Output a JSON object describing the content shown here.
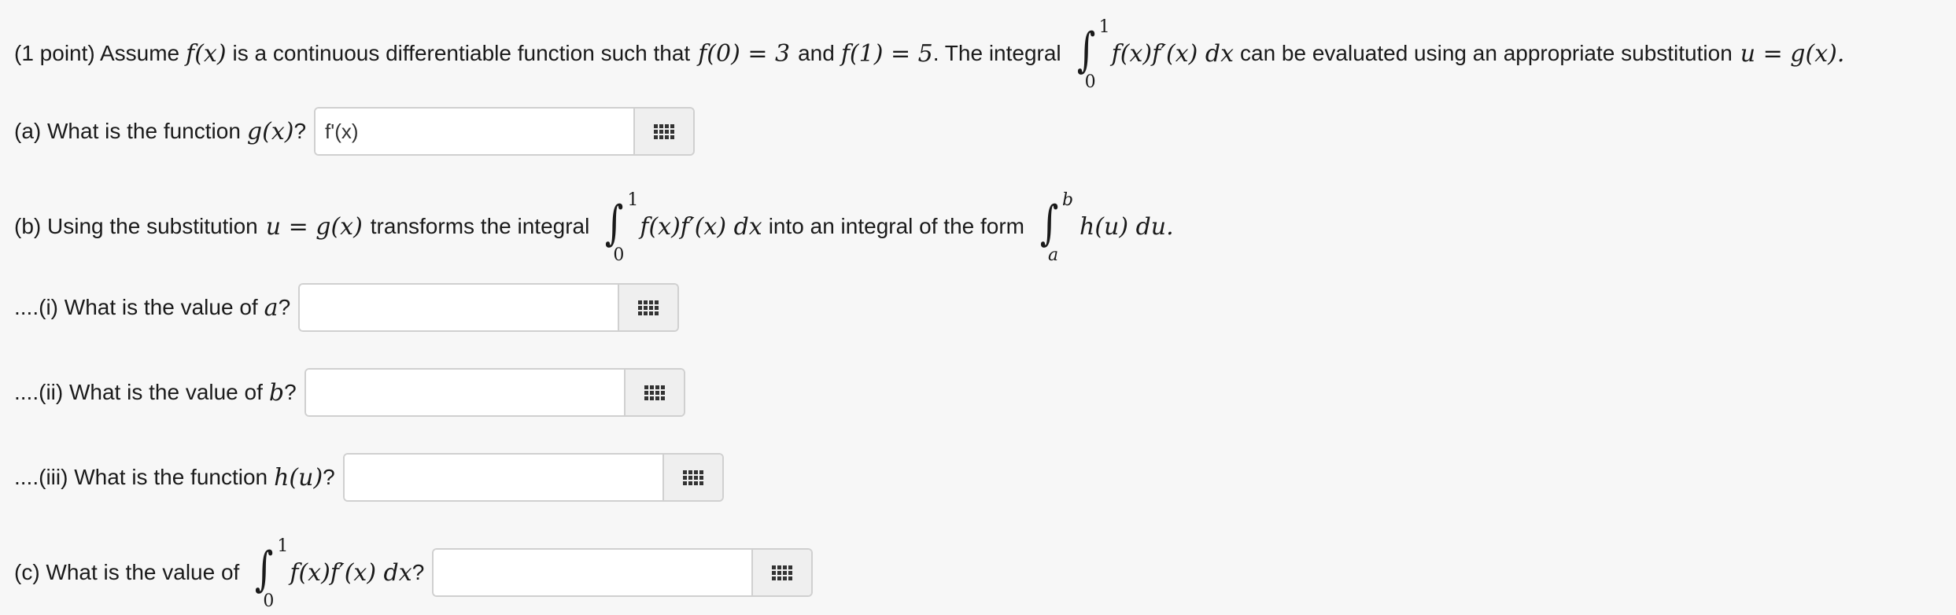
{
  "problem": {
    "intro_prefix": "(1 point) Assume",
    "intro_f": "f(x)",
    "intro_mid": "is a continuous differentiable function such that",
    "intro_cond1": "f(0) = 3",
    "intro_and": "and",
    "intro_cond2": "f(1) = 5",
    "intro_integral_label": ". The integral",
    "integral_upper": "1",
    "integral_lower": "0",
    "integrand": "f(x)f′(x) dx",
    "intro_suffix": "can be evaluated using an appropriate substitution",
    "substitution": "u = g(x)."
  },
  "part_a": {
    "label": "(a) What is the function",
    "symbol": "g(x)",
    "question_mark": "?",
    "input_value": "f'(x)",
    "input_placeholder": ""
  },
  "part_b": {
    "label_prefix": "(b) Using the substitution",
    "substitution": "u = g(x)",
    "label_mid": "transforms the integral",
    "integral_upper": "1",
    "integral_lower": "0",
    "integrand": "f(x)f′(x) dx",
    "label_form": "into an integral of the form",
    "form_upper": "b",
    "form_lower": "a",
    "form_integrand": "h(u) du."
  },
  "part_b_i": {
    "label": "....(i) What is the value of",
    "symbol": "a",
    "question_mark": "?",
    "input_value": ""
  },
  "part_b_ii": {
    "label": "....(ii) What is the value of",
    "symbol": "b",
    "question_mark": "?",
    "input_value": ""
  },
  "part_b_iii": {
    "label": "....(iii) What is the function",
    "symbol": "h(u)",
    "question_mark": "?",
    "input_value": ""
  },
  "part_c": {
    "label": "(c) What is the value of",
    "integral_upper": "1",
    "integral_lower": "0",
    "integrand": "f(x)f′(x) dx",
    "question_mark": "?",
    "input_value": ""
  },
  "icons": {
    "palette": "equation-palette-icon"
  }
}
